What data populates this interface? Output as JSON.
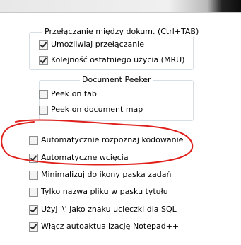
{
  "group_switching": {
    "title": "Przełączanie między dokum. (Ctrl+TAB)",
    "items": [
      {
        "label": "Umożliwiaj przełączanie",
        "checked": true
      },
      {
        "label": "Kolejność ostatniego użycia (MRU)",
        "checked": true
      }
    ]
  },
  "group_peeker": {
    "title": "Document Peeker",
    "items": [
      {
        "label": "Peek on tab",
        "checked": false
      },
      {
        "label": "Peek on document map",
        "checked": false
      }
    ]
  },
  "options": [
    {
      "label": "Automatycznie rozpoznaj kodowanie",
      "checked": false
    },
    {
      "label": "Automatyczne wcięcia",
      "checked": true
    },
    {
      "label": "Minimalizuj do ikony paska zadań",
      "checked": false
    },
    {
      "label": "Tylko nazwa pliku w pasku tytułu",
      "checked": false
    },
    {
      "label": "Użyj '\\' jako znaku ucieczki dla SQL",
      "checked": true
    },
    {
      "label": "Włącz autoaktualizację Notepad++",
      "checked": true
    }
  ],
  "annotation_color": "#e0201b"
}
